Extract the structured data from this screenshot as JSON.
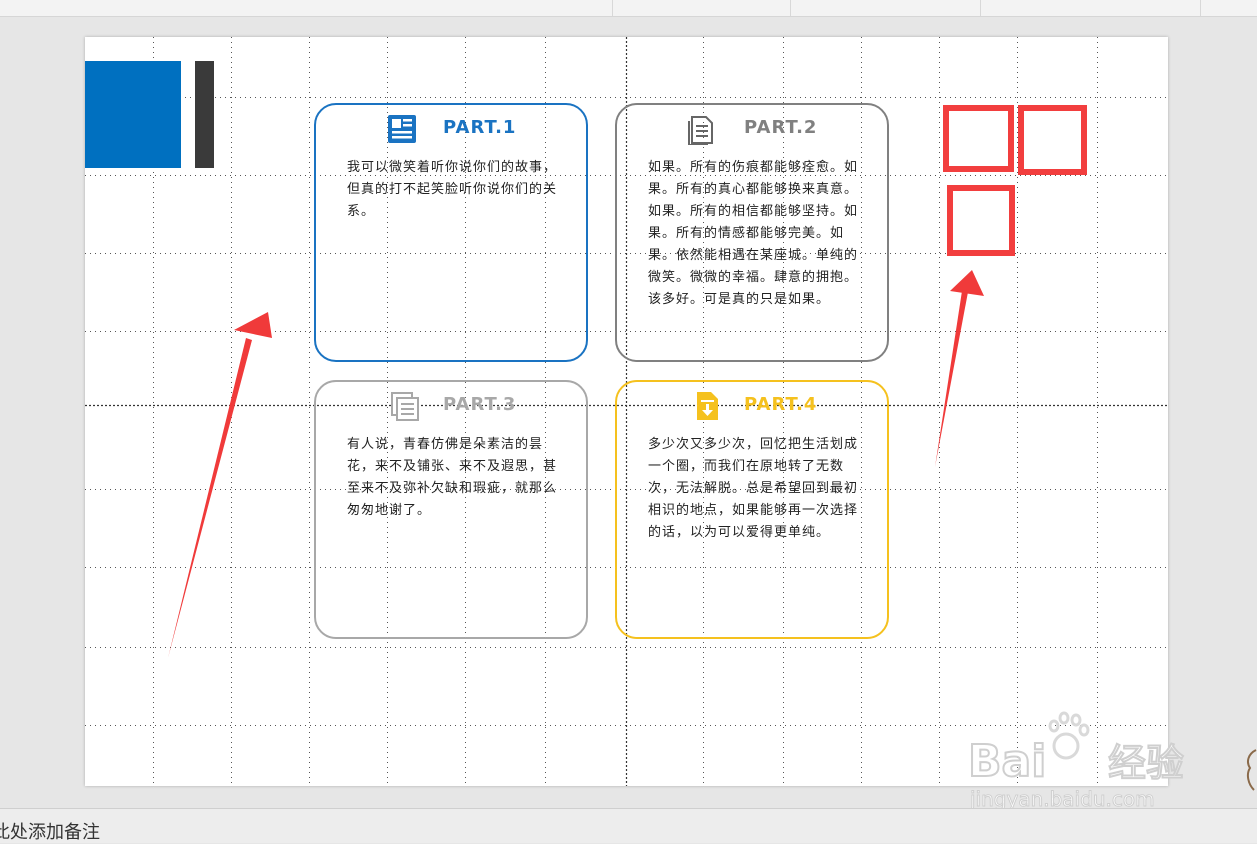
{
  "cards": [
    {
      "title": "PART.1",
      "color": "#1a73c2",
      "icon": "newspaper-icon",
      "text": "我可以微笑着听你说你们的故事，但真的打不起笑脸听你说你们的关系。"
    },
    {
      "title": "PART.2",
      "color": "#808080",
      "icon": "document-icon",
      "text": "如果。所有的伤痕都能够痊愈。如果。所有的真心都能够换来真意。 如果。所有的相信都能够坚持。如果。所有的情感都能够完美。如果。依然能相遇在某座城。单纯的微笑。微微的幸福。肆意的拥抱。 该多好。可是真的只是如果。"
    },
    {
      "title": "PART.3",
      "color": "#a8a8a8",
      "icon": "stacked-documents-icon",
      "text": "有人说，青春仿佛是朵素洁的昙花，来不及铺张、来不及遐思，甚至来不及弥补欠缺和瑕疵，就那么匆匆地谢了。"
    },
    {
      "title": "PART.4",
      "color": "#f5c11e",
      "icon": "download-file-icon",
      "text": "多少次又多少次，回忆把生活划成一个圈，而我们在原地转了无数次，无法解脱。总是希望回到最初相识的地点，如果能够再一次选择的话，以为可以爱得更单纯。"
    }
  ],
  "notes_placeholder": "此处添加备注",
  "watermark": {
    "brand": "Bai",
    "brand_suffix": "经验",
    "url": "jingyan.baidu.com",
    "icon": "paw-icon"
  },
  "colors": {
    "accent_blue": "#0070c0",
    "dark_bar": "#3a3a3a",
    "annotation_red": "#f23e3e"
  }
}
